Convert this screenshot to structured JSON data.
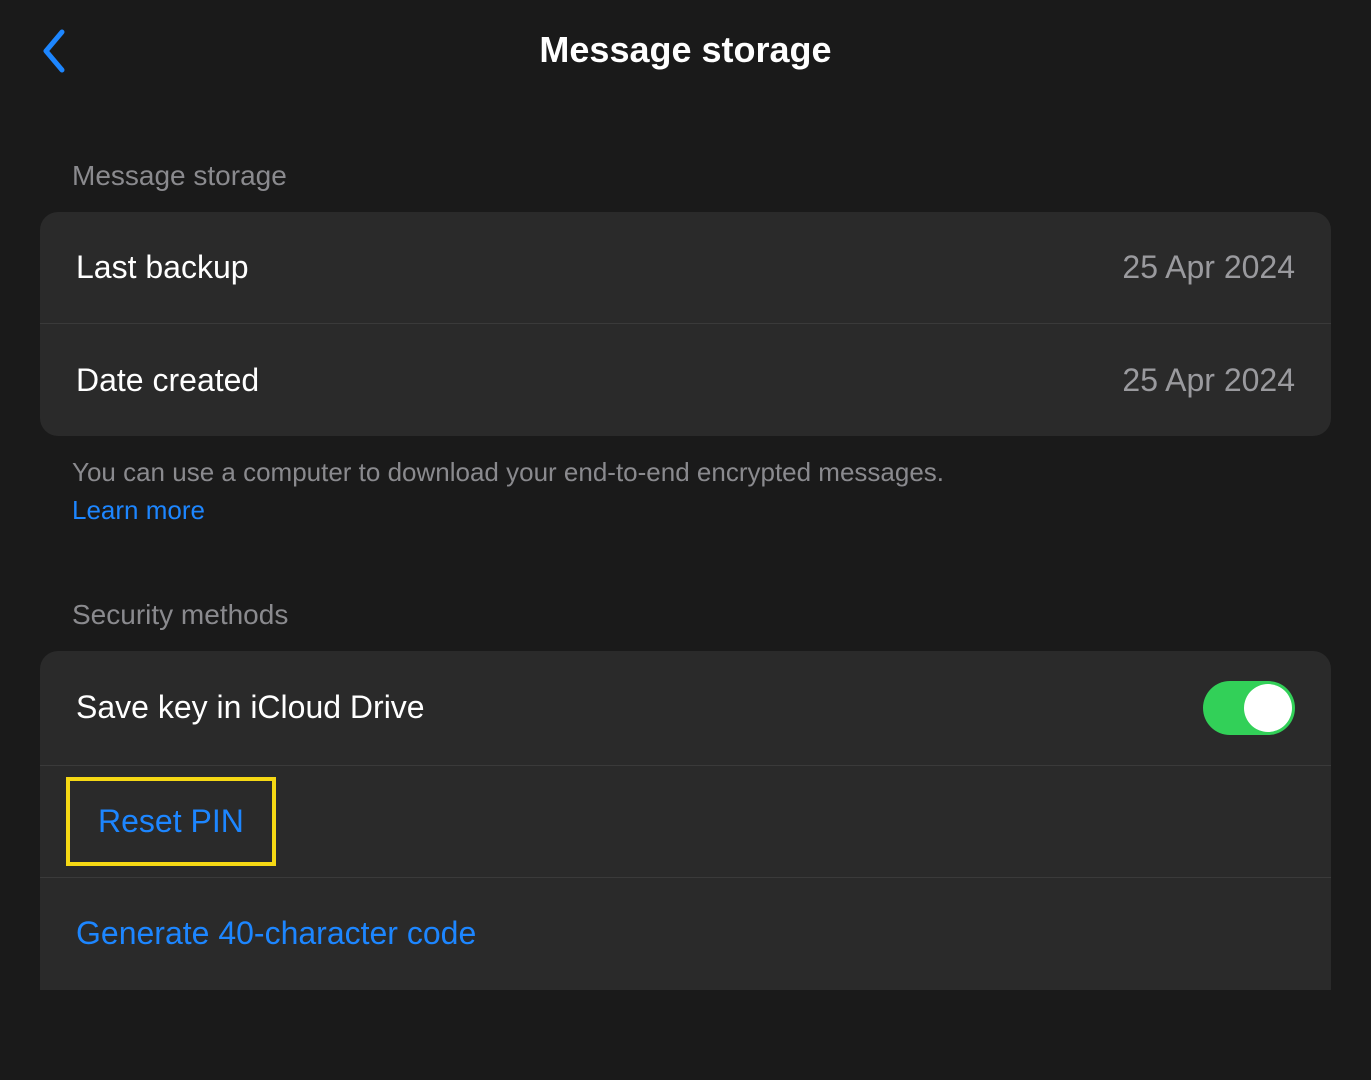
{
  "header": {
    "title": "Message storage"
  },
  "storage": {
    "section_label": "Message storage",
    "last_backup": {
      "label": "Last backup",
      "value": "25 Apr 2024"
    },
    "date_created": {
      "label": "Date created",
      "value": "25 Apr 2024"
    },
    "footer": "You can use a computer to download your end-to-end encrypted messages.",
    "learn_more": "Learn more"
  },
  "security": {
    "section_label": "Security methods",
    "icloud": {
      "label": "Save key in iCloud Drive",
      "enabled": true
    },
    "reset_pin": "Reset PIN",
    "generate_code": "Generate 40-character code"
  },
  "colors": {
    "accent": "#1d86ff",
    "toggle_on": "#32d058",
    "highlight": "#f5d814"
  }
}
